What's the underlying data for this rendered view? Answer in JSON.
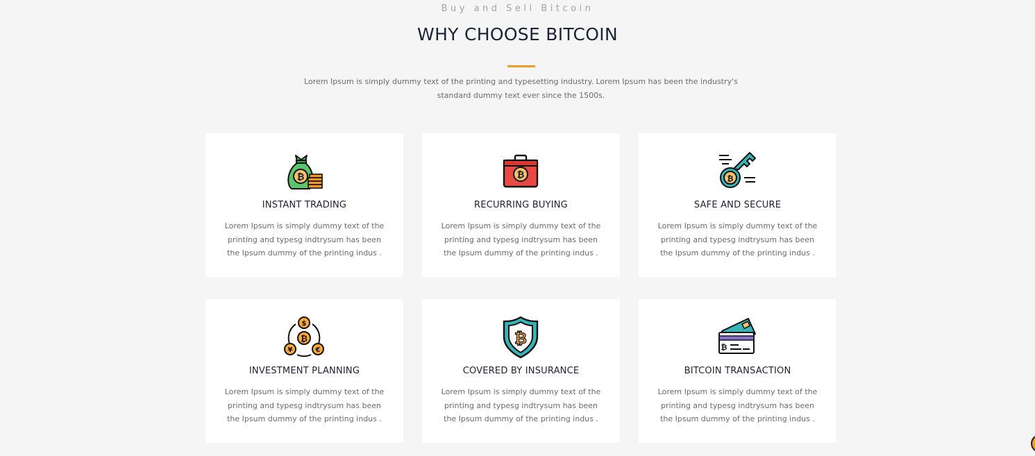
{
  "header": {
    "eyebrow": "Buy and Sell Bitcoin",
    "title": "WHY CHOOSE BITCOIN",
    "intro": "Lorem Ipsum is simply dummy text of the printing and typesetting industry. Lorem Ipsum has been the industry's standard dummy text ever since the 1500s."
  },
  "colors": {
    "accent": "#f29a21",
    "background": "#f4f5f4",
    "card": "#ffffff",
    "heading": "#1b2336",
    "body_text": "#6b6b6b"
  },
  "features": [
    {
      "icon": "bitcoin-money-bag-icon",
      "title": "INSTANT TRADING",
      "text": "Lorem Ipsum is simply dummy text of the printing and typesg indtrysum has been the Ipsum dummy of the printing indus ."
    },
    {
      "icon": "bitcoin-briefcase-icon",
      "title": "RECURRING BUYING",
      "text": "Lorem Ipsum is simply dummy text of the printing and typesg indtrysum has been the Ipsum dummy of the printing indus ."
    },
    {
      "icon": "bitcoin-key-icon",
      "title": "SAFE AND SECURE",
      "text": "Lorem Ipsum is simply dummy text of the printing and typesg indtrysum has been the Ipsum dummy of the printing indus ."
    },
    {
      "icon": "currency-exchange-icon",
      "title": "INVESTMENT PLANNING",
      "text": "Lorem Ipsum is simply dummy text of the printing and typesg indtrysum has been the Ipsum dummy of the printing indus ."
    },
    {
      "icon": "bitcoin-shield-icon",
      "title": "COVERED BY INSURANCE",
      "text": "Lorem Ipsum is simply dummy text of the printing and typesg indtrysum has been the Ipsum dummy of the printing indus ."
    },
    {
      "icon": "bitcoin-card-icon",
      "title": "BITCOIN TRANSACTION",
      "text": "Lorem Ipsum is simply dummy text of the printing and typesg indtrysum has been the Ipsum dummy of the printing indus ."
    }
  ]
}
